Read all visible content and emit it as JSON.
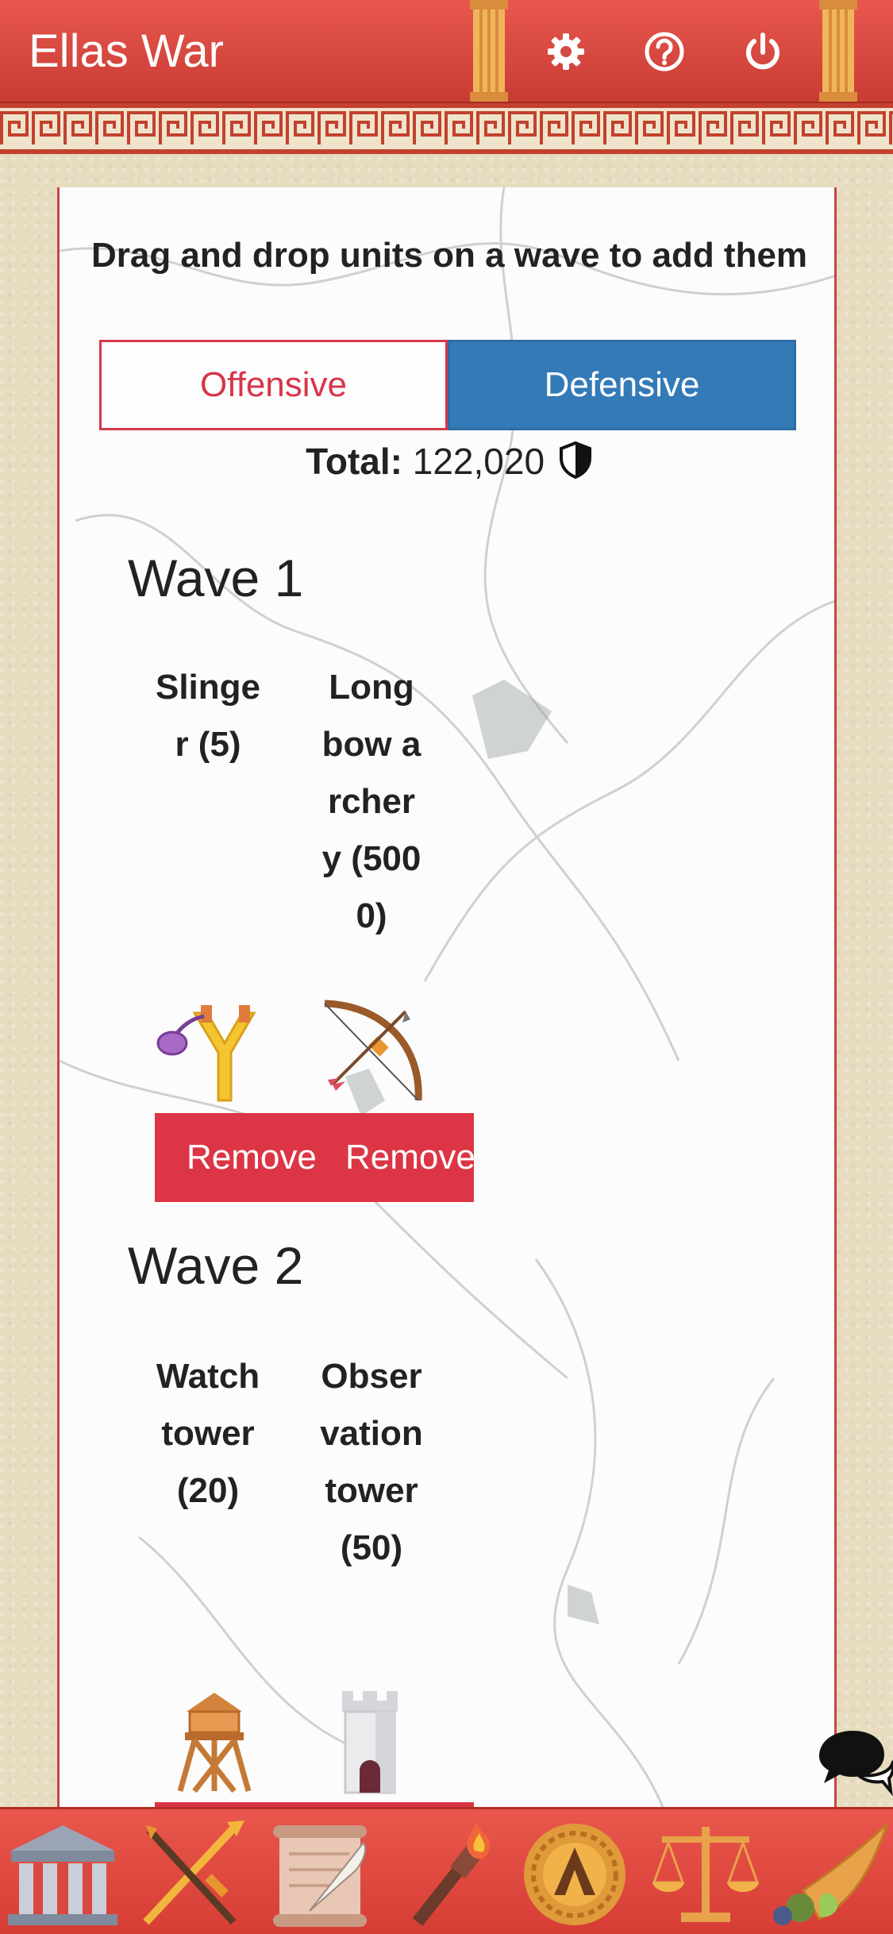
{
  "header": {
    "title": "Ellas War",
    "icons": [
      "gear-icon",
      "help-circle-icon",
      "power-icon"
    ],
    "colors": {
      "bar": "#d9473f",
      "pillar": "#e8a24a"
    }
  },
  "panel": {
    "instructions": "Drag and drop units on a wave to add them",
    "tabs": {
      "offensive": "Offensive",
      "defensive": "Defensive",
      "active": "Defensive"
    },
    "total_label": "Total:",
    "total_value": "122,020",
    "total_icon": "shield-icon"
  },
  "waves": [
    {
      "title": "Wave 1",
      "units": [
        {
          "name": "Slinger (5)",
          "icon": "slingshot-icon",
          "remove": "Remove"
        },
        {
          "name": "Longbow archery (5000)",
          "icon": "bow-arrow-icon",
          "remove": "Remove"
        }
      ]
    },
    {
      "title": "Wave 2",
      "units": [
        {
          "name": "Watchtower (20)",
          "icon": "watchtower-icon"
        },
        {
          "name": "Observation tower (50)",
          "icon": "stone-tower-icon"
        }
      ]
    }
  ],
  "chat": {
    "icon": "chat-bubbles-icon"
  },
  "bottom_nav": {
    "items": [
      "temple-icon",
      "crossed-swords-icon",
      "scroll-quill-icon",
      "torch-icon",
      "spartan-shield-icon",
      "scales-icon",
      "cornucopia-icon"
    ]
  },
  "colors": {
    "offensive": "#d63649",
    "defensive": "#337ab7",
    "remove": "#dc3545",
    "background": "#e7dcc0"
  }
}
